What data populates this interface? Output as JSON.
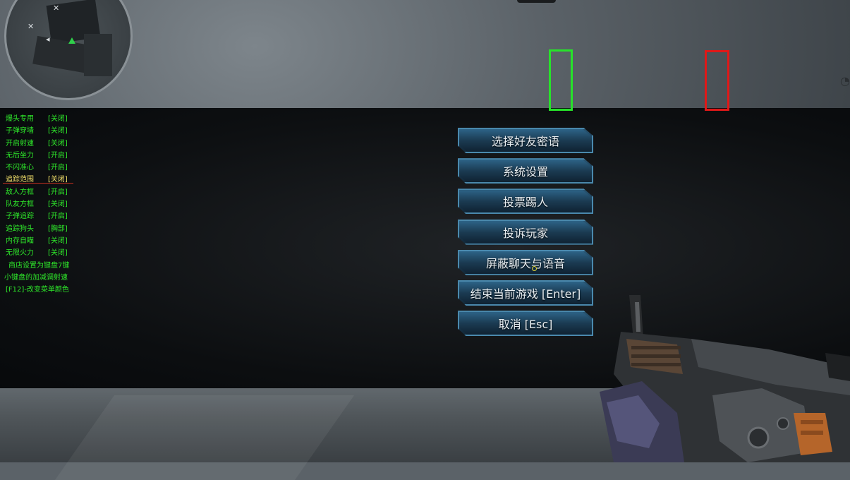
{
  "cheat_menu": {
    "rows": [
      {
        "name": "爆头专用",
        "state": "[关闭]"
      },
      {
        "name": "子弹穿墙",
        "state": "[关闭]"
      },
      {
        "name": "开启射速",
        "state": "[关闭]"
      },
      {
        "name": "无后坐力",
        "state": "[开启]"
      },
      {
        "name": "不闪准心",
        "state": "[开启]"
      },
      {
        "name": "追踪范围",
        "state": "[关闭]"
      },
      {
        "name": "敌人方框",
        "state": "[开启]"
      },
      {
        "name": "队友方框",
        "state": "[关闭]"
      },
      {
        "name": "子弹追踪",
        "state": "[开启]"
      },
      {
        "name": "追踪狗头",
        "state": "[胸部]"
      },
      {
        "name": "内存自瞄",
        "state": "[关闭]"
      },
      {
        "name": "无限火力",
        "state": "[关闭]"
      }
    ],
    "notes": [
      "商店设置为键盘7键",
      "小键盘的加减调射速",
      "[F12]-改变菜单颜色"
    ],
    "highlighted_index": 5
  },
  "pause_menu": {
    "buttons": [
      "选择好友密语",
      "系统设置",
      "投票踢人",
      "投诉玩家",
      "屏蔽聊天与语音",
      "结束当前游戏 [Enter]",
      "取消 [Esc]"
    ]
  },
  "colors": {
    "cheat_text": "#2ee82a",
    "highlight_text": "#f2e06a",
    "enemy_box": "#e01818",
    "ally_box": "#27e22a",
    "button_fill": "#1c3c54",
    "button_edge": "#4a89ad"
  },
  "icons": {
    "player_marker": "green-triangle",
    "minimap": "circular-radar"
  }
}
